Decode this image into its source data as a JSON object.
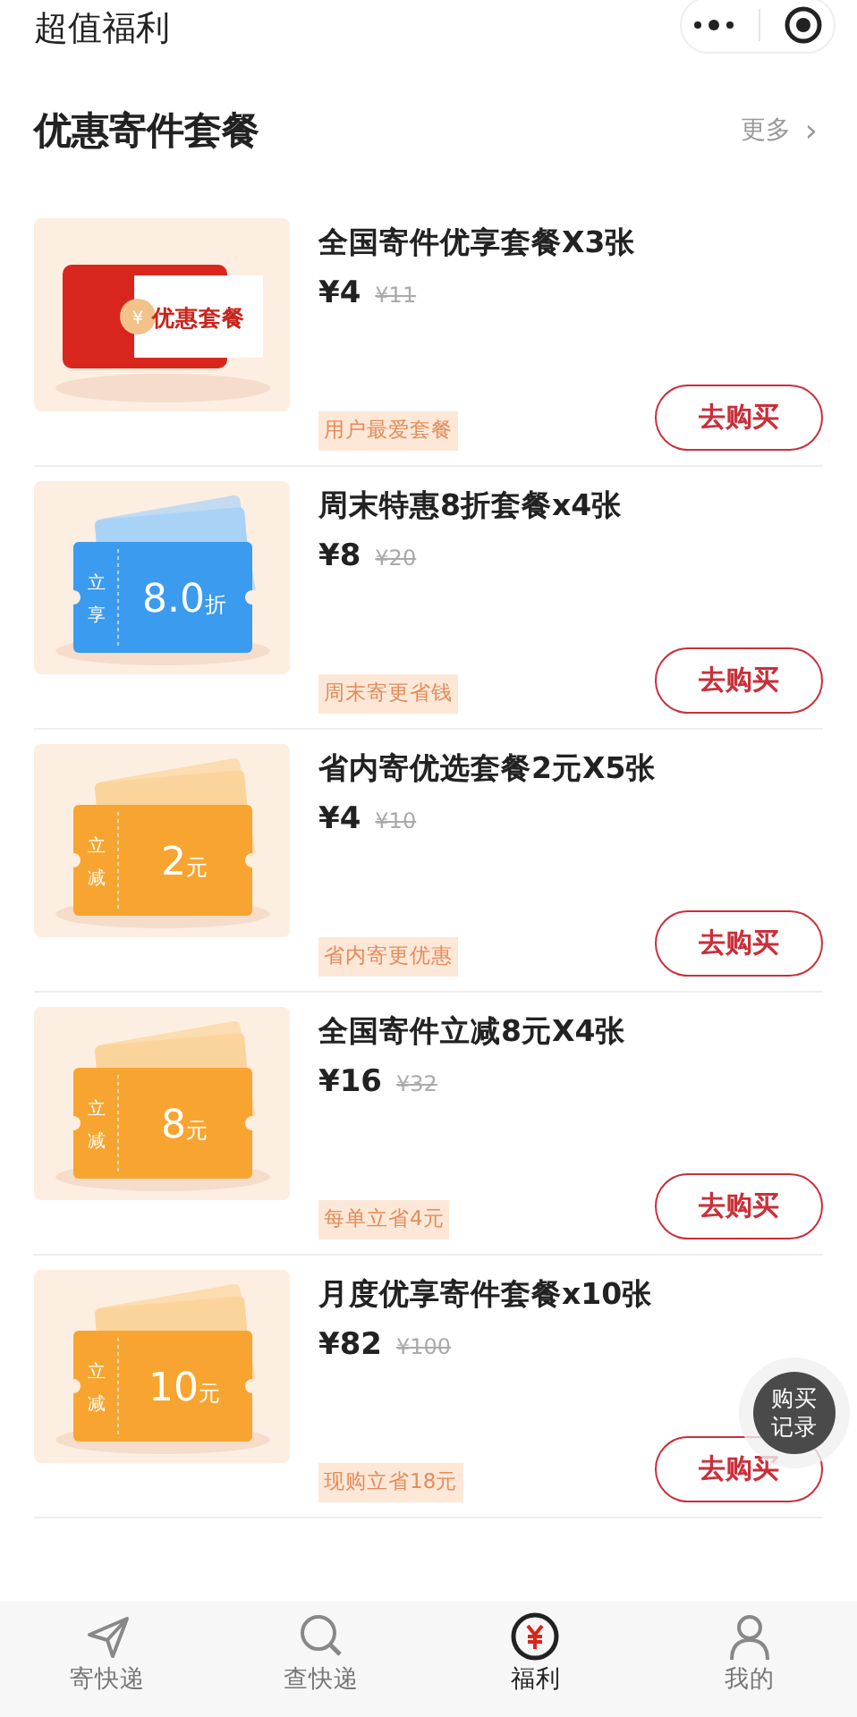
{
  "header": {
    "title": "超值福利"
  },
  "section": {
    "title": "优惠寄件套餐",
    "more": "更多",
    "more_arrow": "›"
  },
  "packages": [
    {
      "name": "全国寄件优享套餐X3张",
      "price": "¥4",
      "original_price": "¥11",
      "tag": "用户最爱套餐",
      "button": "去购买",
      "image": {
        "kind": "package",
        "coin": "¥",
        "label": "优惠套餐"
      }
    },
    {
      "name": "周末特惠8折套餐x4张",
      "price": "¥8",
      "original_price": "¥20",
      "tag": "周末寄更省钱",
      "button": "去购买",
      "image": {
        "kind": "discount",
        "side": "立享",
        "amount": "8.0",
        "unit": "折"
      }
    },
    {
      "name": "省内寄优选套餐2元X5张",
      "price": "¥4",
      "original_price": "¥10",
      "tag": "省内寄更优惠",
      "button": "去购买",
      "image": {
        "kind": "cash",
        "side": "立减",
        "amount": "2",
        "unit": "元"
      }
    },
    {
      "name": "全国寄件立减8元X4张",
      "price": "¥16",
      "original_price": "¥32",
      "tag": "每单立省4元",
      "button": "去购买",
      "image": {
        "kind": "cash",
        "side": "立减",
        "amount": "8",
        "unit": "元"
      }
    },
    {
      "name": "月度优享寄件套餐x10张",
      "price": "¥82",
      "original_price": "¥100",
      "tag": "现购立省18元",
      "button": "去购买",
      "image": {
        "kind": "cash",
        "side": "立减",
        "amount": "10",
        "unit": "元"
      }
    }
  ],
  "float_button": "购买记录",
  "tab_bar": [
    {
      "label": "寄快递",
      "kind": "send",
      "selected": false
    },
    {
      "label": "查快递",
      "kind": "search",
      "selected": false
    },
    {
      "label": "福利",
      "kind": "yen",
      "selected": true
    },
    {
      "label": "我的",
      "kind": "user",
      "selected": false
    }
  ]
}
